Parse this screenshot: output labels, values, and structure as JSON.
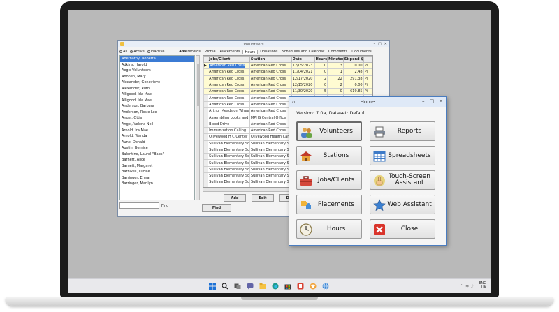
{
  "volunteers_window": {
    "title": "Volunteers",
    "filters": {
      "all": "All",
      "active": "Active",
      "inactive": "Inactive"
    },
    "records_count": "489",
    "records_label": "records",
    "names": [
      "Abernathy, Roberta",
      "Adkins, Harold",
      "Aegis Volunteers",
      "Ahonen, Mary",
      "Alexander, Genevieve",
      "Alexander, Ruth",
      "Alligood, Ida Mae",
      "Alligood, Ida Mae",
      "Anderson, Barbara",
      "Anderson, Rosie Lee",
      "Angel, Ottis",
      "Angel, Velena Nell",
      "Arnold, Ira Mae",
      "Arnold, Wanda",
      "Aune, Donald",
      "Austin, Bernice",
      "Balentine, Laurel \"Babs\"",
      "Barnett, Alice",
      "Barnett, Margaret",
      "Barnwell, Lucille",
      "Barringer, Erma",
      "Barringer, Marilyn"
    ],
    "find_label": "Find",
    "tabs": [
      "Profile",
      "Placements",
      "Hours",
      "Donations",
      "Schedules and Calendar",
      "Comments",
      "Documents"
    ],
    "active_tab": "Hours",
    "columns": [
      "Jobs/Client",
      "Station",
      "Date",
      "Hours",
      "Minutes",
      "Stipend $",
      ""
    ],
    "rows": [
      {
        "job": "American Red Cross",
        "station": "American Red Cross",
        "date": "12/05/2023",
        "hours": "0",
        "minutes": "3",
        "stipend": "0.00",
        "extra": "Pi"
      },
      {
        "job": "American Red Cross",
        "station": "American Red Cross",
        "date": "11/04/2021",
        "hours": "0",
        "minutes": "1",
        "stipend": "2.48",
        "extra": "Pi"
      },
      {
        "job": "American Red Cross",
        "station": "American Red Cross",
        "date": "12/17/2020",
        "hours": "2",
        "minutes": "22",
        "stipend": "291.38",
        "extra": "Pi"
      },
      {
        "job": "American Red Cross",
        "station": "American Red Cross",
        "date": "12/15/2020",
        "hours": "0",
        "minutes": "2",
        "stipend": "0.00",
        "extra": "Pi"
      },
      {
        "job": "American Red Cross",
        "station": "American Red Cross",
        "date": "11/30/2020",
        "hours": "5",
        "minutes": "0",
        "stipend": "619.85",
        "extra": "Pi"
      },
      {
        "job": "American Red Cross",
        "station": "American Red Cross",
        "date": "",
        "hours": "",
        "minutes": "",
        "stipend": "",
        "extra": ""
      },
      {
        "job": "American Red Cross",
        "station": "American Red Cross",
        "date": "",
        "hours": "",
        "minutes": "",
        "stipend": "",
        "extra": ""
      },
      {
        "job": "Arthur Meads on Wheels",
        "station": "American Red Cross",
        "date": "",
        "hours": "",
        "minutes": "",
        "stipend": "",
        "extra": ""
      },
      {
        "job": "Assembling books and pa",
        "station": "MPHS Central Office",
        "date": "",
        "hours": "",
        "minutes": "",
        "stipend": "",
        "extra": ""
      },
      {
        "job": "Blood Drive",
        "station": "American Red Cross",
        "date": "",
        "hours": "",
        "minutes": "",
        "stipend": "",
        "extra": ""
      },
      {
        "job": "Immunization Calling",
        "station": "American Red Cross",
        "date": "",
        "hours": "",
        "minutes": "",
        "stipend": "",
        "extra": ""
      },
      {
        "job": "Olivewood H C Center wo",
        "station": "Olivewood Health Care",
        "date": "",
        "hours": "",
        "minutes": "",
        "stipend": "",
        "extra": ""
      },
      {
        "job": "Sullivan Elementary Scho",
        "station": "Sullivan Elementary Scho",
        "date": "",
        "hours": "",
        "minutes": "",
        "stipend": "",
        "extra": ""
      },
      {
        "job": "Sullivan Elementary Scho",
        "station": "Sullivan Elementary Scho",
        "date": "",
        "hours": "",
        "minutes": "",
        "stipend": "",
        "extra": ""
      },
      {
        "job": "Sullivan Elementary Scho",
        "station": "Sullivan Elementary Scho",
        "date": "",
        "hours": "",
        "minutes": "",
        "stipend": "",
        "extra": ""
      },
      {
        "job": "Sullivan Elementary Scho",
        "station": "Sullivan Elementary Scho",
        "date": "",
        "hours": "",
        "minutes": "",
        "stipend": "",
        "extra": ""
      },
      {
        "job": "Sullivan Elementary Scho",
        "station": "Sullivan Elementary Scho",
        "date": "",
        "hours": "",
        "minutes": "",
        "stipend": "",
        "extra": ""
      },
      {
        "job": "Sullivan Elementary Scho",
        "station": "Sullivan Elementary Scho",
        "date": "",
        "hours": "",
        "minutes": "",
        "stipend": "",
        "extra": ""
      },
      {
        "job": "Sullivan Elementary Scho",
        "station": "Sullivan Elementary Scho",
        "date": "",
        "hours": "",
        "minutes": "",
        "stipend": "",
        "extra": ""
      },
      {
        "job": "Sullivan Elementary Scho",
        "station": "Sullivan Elementary Scho",
        "date": "",
        "hours": "",
        "minutes": "",
        "stipend": "",
        "extra": ""
      },
      {
        "job": "Sullivan Elementary Scho",
        "station": "Sullivan Elementary Scho",
        "date": "",
        "hours": "",
        "minutes": "",
        "stipend": "",
        "extra": ""
      }
    ],
    "buttons": {
      "add": "Add",
      "edit": "Edit",
      "delete": "Dele",
      "find": "Find"
    }
  },
  "home_window": {
    "title": "Home",
    "version": "Version: 7.0a, Dataset: Default",
    "buttons": {
      "volunteers": "Volunteers",
      "reports": "Reports",
      "stations": "Stations",
      "spreadsheets": "Spreadsheets",
      "jobs_clients": "Jobs/Clients",
      "touch_screen": "Touch-Screen Assistant",
      "placements": "Placements",
      "web_assistant": "Web Assistant",
      "hours": "Hours",
      "close": "Close"
    }
  },
  "taskbar": {
    "lang": "ENG",
    "region": "UK"
  },
  "colors": {
    "selection": "#3b7bd4",
    "title_border": "#4a7cbf",
    "close_red": "#d9342b"
  }
}
